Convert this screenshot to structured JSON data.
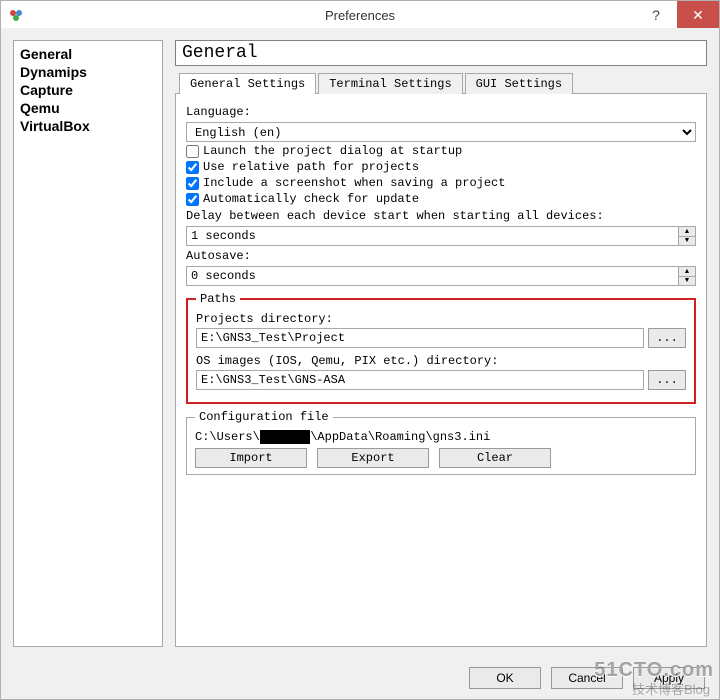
{
  "window": {
    "title": "Preferences",
    "help": "?",
    "close": "✕"
  },
  "sidebar": {
    "items": [
      "General",
      "Dynamips",
      "Capture",
      "Qemu",
      "VirtualBox"
    ]
  },
  "page": {
    "heading": "General"
  },
  "tabs": {
    "items": [
      "General Settings",
      "Terminal Settings",
      "GUI Settings"
    ],
    "active": 0
  },
  "lang": {
    "label": "Language:",
    "value": "English (en)"
  },
  "checks": {
    "launch": {
      "label": "Launch the project dialog at startup",
      "checked": false
    },
    "relpath": {
      "label": "Use relative path for projects",
      "checked": true
    },
    "screenshot": {
      "label": "Include a screenshot when saving a project",
      "checked": true
    },
    "update": {
      "label": "Automatically check for update",
      "checked": true
    }
  },
  "delay": {
    "label": "Delay between each device start when starting all devices:",
    "value": "1 seconds"
  },
  "autosave": {
    "label": "Autosave:",
    "value": "0 seconds"
  },
  "paths": {
    "legend": "Paths",
    "proj_label": "Projects directory:",
    "proj_value": "E:\\GNS3_Test\\Project",
    "os_label": "OS images (IOS, Qemu, PIX etc.) directory:",
    "os_value": "E:\\GNS3_Test\\GNS-ASA",
    "browse": "..."
  },
  "config": {
    "legend": "Configuration file",
    "path_prefix": "C:\\Users\\",
    "path_suffix": "\\AppData\\Roaming\\gns3.ini",
    "import": "Import",
    "export": "Export",
    "clear": "Clear"
  },
  "buttons": {
    "ok": "OK",
    "cancel": "Cancel",
    "apply": "Apply"
  },
  "watermark": {
    "big": "51CTO.com",
    "small": "技术博客Blog"
  }
}
